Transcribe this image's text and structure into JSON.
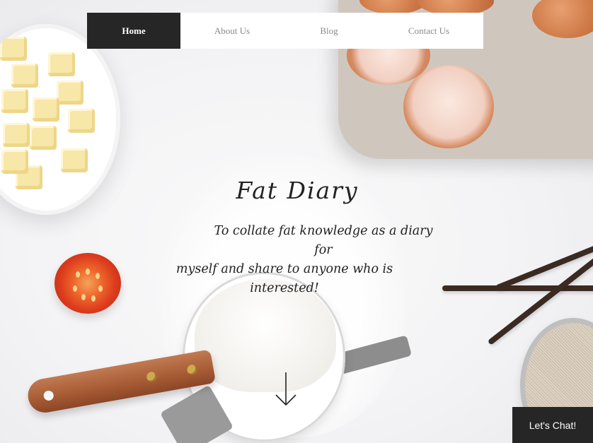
{
  "nav": {
    "items": [
      {
        "label": "Home",
        "active": true
      },
      {
        "label": "About Us",
        "active": false
      },
      {
        "label": "Blog",
        "active": false
      },
      {
        "label": "Contact Us",
        "active": false
      }
    ]
  },
  "hero": {
    "title": "Fat Diary",
    "subtitle_line1": "To collate fat knowledge as a diary for",
    "subtitle_line2": "myself and share to anyone who is interested!",
    "scroll_icon": "arrow-down-icon"
  },
  "chat": {
    "label": "Let's Chat!"
  },
  "colors": {
    "nav_active_bg": "#262626",
    "nav_text": "#8a8a8a",
    "top_accent": "#e3b7e3",
    "chat_bg": "#262626"
  }
}
